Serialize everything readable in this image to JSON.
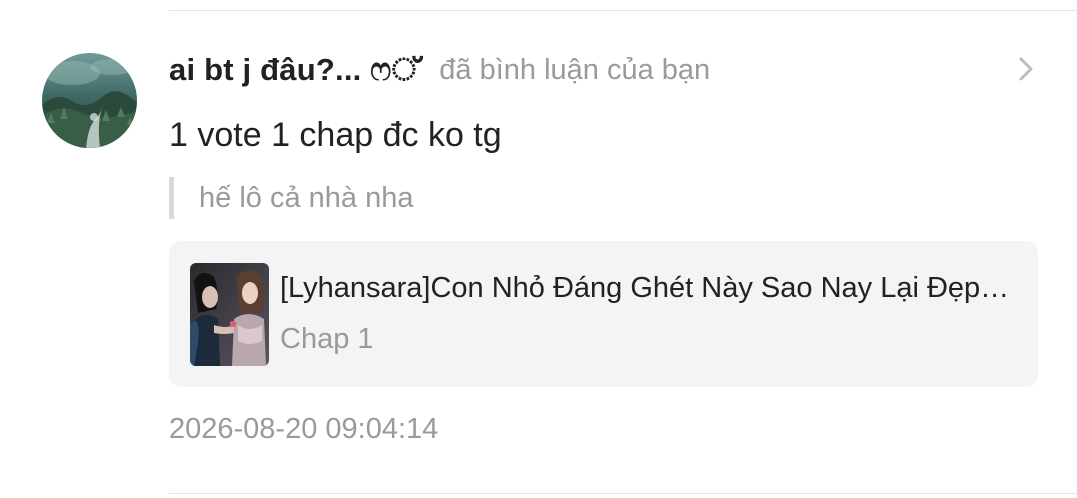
{
  "notification": {
    "username": "ai bt j đâu?... ෆ്",
    "action": "đã bình luận của bạn",
    "comment": "1 vote 1 chap đc ko tg",
    "quoted_comment": "hế lô cả nhà nha",
    "story": {
      "title": "[Lyhansara]Con Nhỏ Đáng Ghét Này Sao Nay Lại Đẹp Vậy",
      "chapter": "Chap 1"
    },
    "timestamp": "2026-08-20 09:04:14"
  },
  "icons": {
    "chevron": "chevron-right-icon",
    "avatar": "user-avatar-image",
    "cover": "story-cover-image"
  },
  "colors": {
    "primary_text": "#222222",
    "secondary_text": "#9a9a9a",
    "card_background": "#f4f4f4",
    "quote_bar": "#d9d9d9"
  }
}
